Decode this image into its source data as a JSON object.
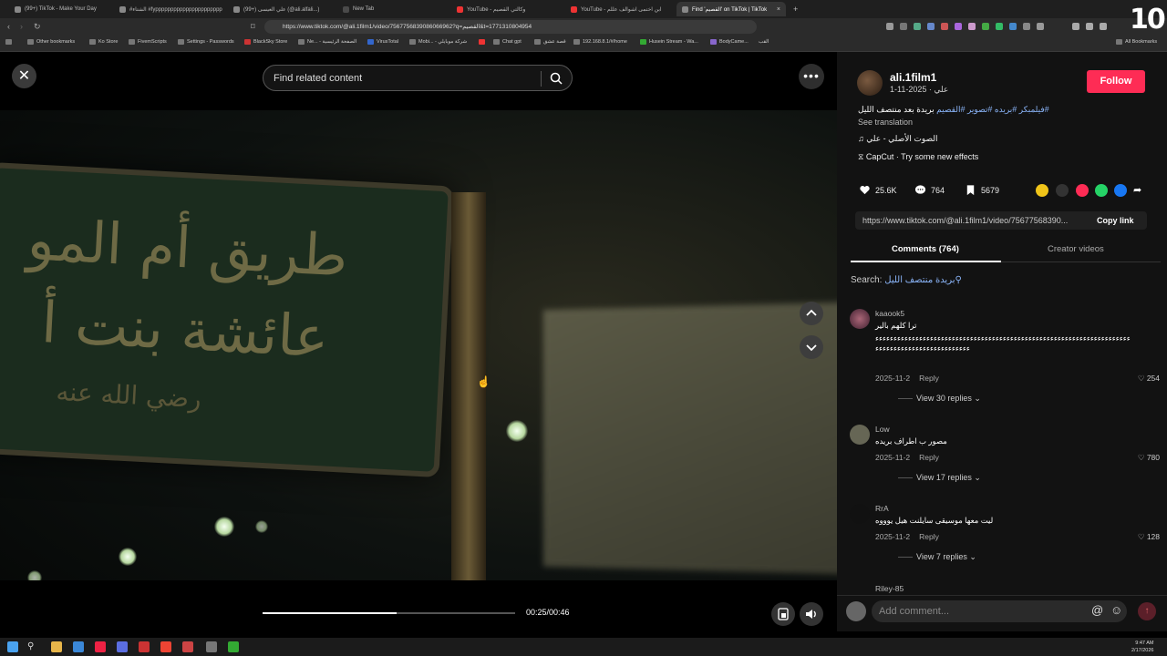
{
  "browser": {
    "tabs": [
      {
        "label": "(99+) TikTok - Make Your Day"
      },
      {
        "label": "#الشتاء #fypppppppppppppppppppppp"
      },
      {
        "label": "(99+) علي العيسى (@ali.alfali...)"
      },
      {
        "label": "New Tab"
      },
      {
        "label": "YouTube - وكالتي القصيم"
      },
      {
        "label": "YouTube - ابن اختمى اشوالف عللم"
      },
      {
        "label": "Find 'القصيم' on TikTok | TikTok"
      }
    ],
    "url": "https://www.tiktok.com/@ali.1film1/video/7567756839086066962?q=القصيم&t=1771310804954",
    "bookmarks": [
      "Other bookmarks",
      "Ko Store",
      "FivemScripts",
      "Settings - Passwords",
      "BlackSky Store",
      "Ne... - الصفحة الرئيسية",
      "VirusTotal",
      "Mobi... - شركة موبايلي",
      "Chat gpt",
      "قصة عشق",
      "192.168.8.1/#/home",
      "Husein Stream - Wa...",
      "BodyCame...",
      "القب"
    ],
    "all_bookmarks": "All Bookmarks",
    "corner_badge": "10"
  },
  "video": {
    "search_placeholder": "Find related content",
    "sign_line1": "طريق أم المو",
    "sign_line2": "عائشة بنت أ",
    "sign_line3": "رضي الله عنه",
    "progress": 0.53,
    "timecode": "00:25/00:46"
  },
  "post": {
    "username": "ali.1film1",
    "date": "علي · 2025-11-1",
    "follow_label": "Follow",
    "description_tags": "#فيلمبكر #بريده #تصوير #القصيم",
    "description_text": "بريدة بعد منتصف الليل",
    "see_translation": "See translation",
    "music": "الصوت الأصلي - علي",
    "capcut": "CapCut · Try some new effects",
    "likes": "25.6K",
    "comments_count": "764",
    "saves": "5679",
    "link": "https://www.tiktok.com/@ali.1film1/video/75677568390...",
    "copy_link": "Copy link",
    "tab_comments": "Comments (764)",
    "tab_creator": "Creator videos",
    "search_label": "Search:",
    "search_query": "بريدة منتصف الليل"
  },
  "comments": [
    {
      "user": "kaaook5",
      "text": "ترا كلهم بالير",
      "text2": "ءءءءءءءءءءءءءءءءءءءءءءءءءءءءءءءءءءءءءءءءءءءءءءءءءءءءءءءءءءءءءءءءءءءءءءءءءءءءءءءءءءءءءءءءءءءءءءءء",
      "date": "2025-11-2",
      "reply": "Reply",
      "likes": "254",
      "replies": "View 30 replies"
    },
    {
      "user": "Low",
      "text": "مصور ب اطراف بريده",
      "date": "2025-11-2",
      "reply": "Reply",
      "likes": "780",
      "replies": "View 17 replies"
    },
    {
      "user": "RrA",
      "text": "ليت معها موسيقى سايلنت هيل يوووه",
      "date": "2025-11-2",
      "reply": "Reply",
      "likes": "128",
      "replies": "View 7 replies"
    },
    {
      "user": "Riley-85"
    }
  ],
  "comment_input": {
    "placeholder": "Add comment..."
  },
  "taskbar": {
    "time": "9:47 AM",
    "date": "2/17/2026"
  }
}
